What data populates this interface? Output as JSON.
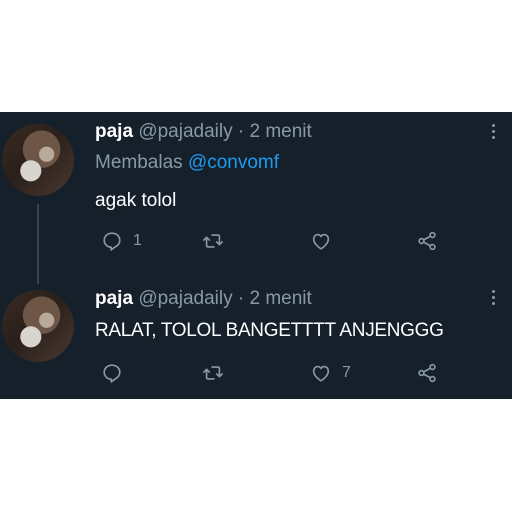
{
  "tweets": [
    {
      "name": "paja",
      "handle": "@pajadaily",
      "separator": "·",
      "time": "2 menit",
      "replying_prefix": "Membalas",
      "replying_to": "@convomf",
      "text": "agak tolol",
      "actions": {
        "reply_count": "1",
        "retweet_count": "",
        "like_count": ""
      }
    },
    {
      "name": "paja",
      "handle": "@pajadaily",
      "separator": "·",
      "time": "2 menit",
      "text": "RALAT, TOLOL BANGETTTT ANJENGGG",
      "actions": {
        "reply_count": "",
        "retweet_count": "",
        "like_count": "7"
      }
    }
  ],
  "icons": [
    "reply-icon",
    "retweet-icon",
    "like-icon",
    "share-icon",
    "more-icon"
  ],
  "colors": {
    "background": "#15202b",
    "text": "#ffffff",
    "muted": "#8899a6",
    "link": "#1d9bf0"
  }
}
